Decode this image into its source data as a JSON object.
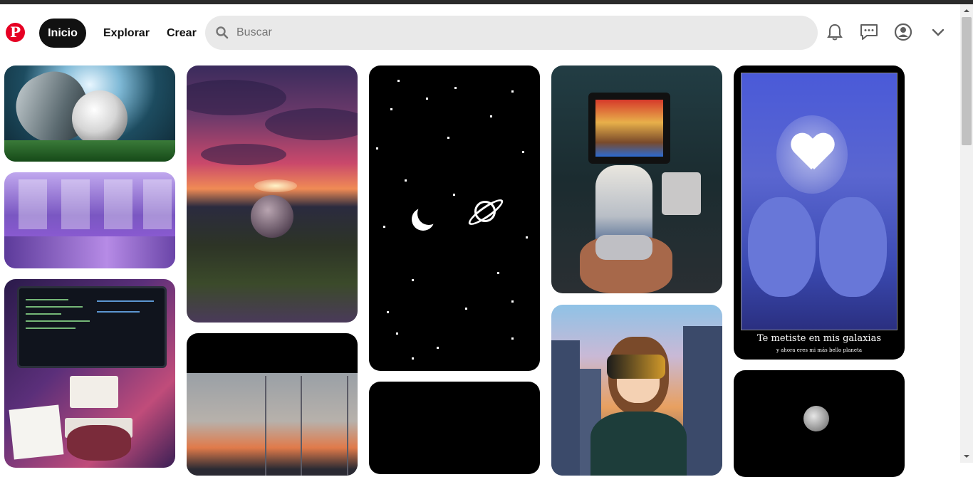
{
  "header": {
    "logo_letter": "P",
    "nav": {
      "home": "Inicio",
      "explore": "Explorar",
      "create": "Crear"
    },
    "search": {
      "placeholder": "Buscar"
    },
    "icons": [
      "pinterest-logo",
      "search-icon",
      "bell-icon",
      "chat-icon",
      "account-icon",
      "chevron-down-icon"
    ]
  },
  "pins": {
    "heart": {
      "caption": "Te metiste en mis galaxias",
      "subcaption": "y ahora eres mi más bello planeta"
    }
  },
  "colors": {
    "brand": "#e60023",
    "active_pill": "#111111",
    "search_bg": "#e9e9e9"
  }
}
